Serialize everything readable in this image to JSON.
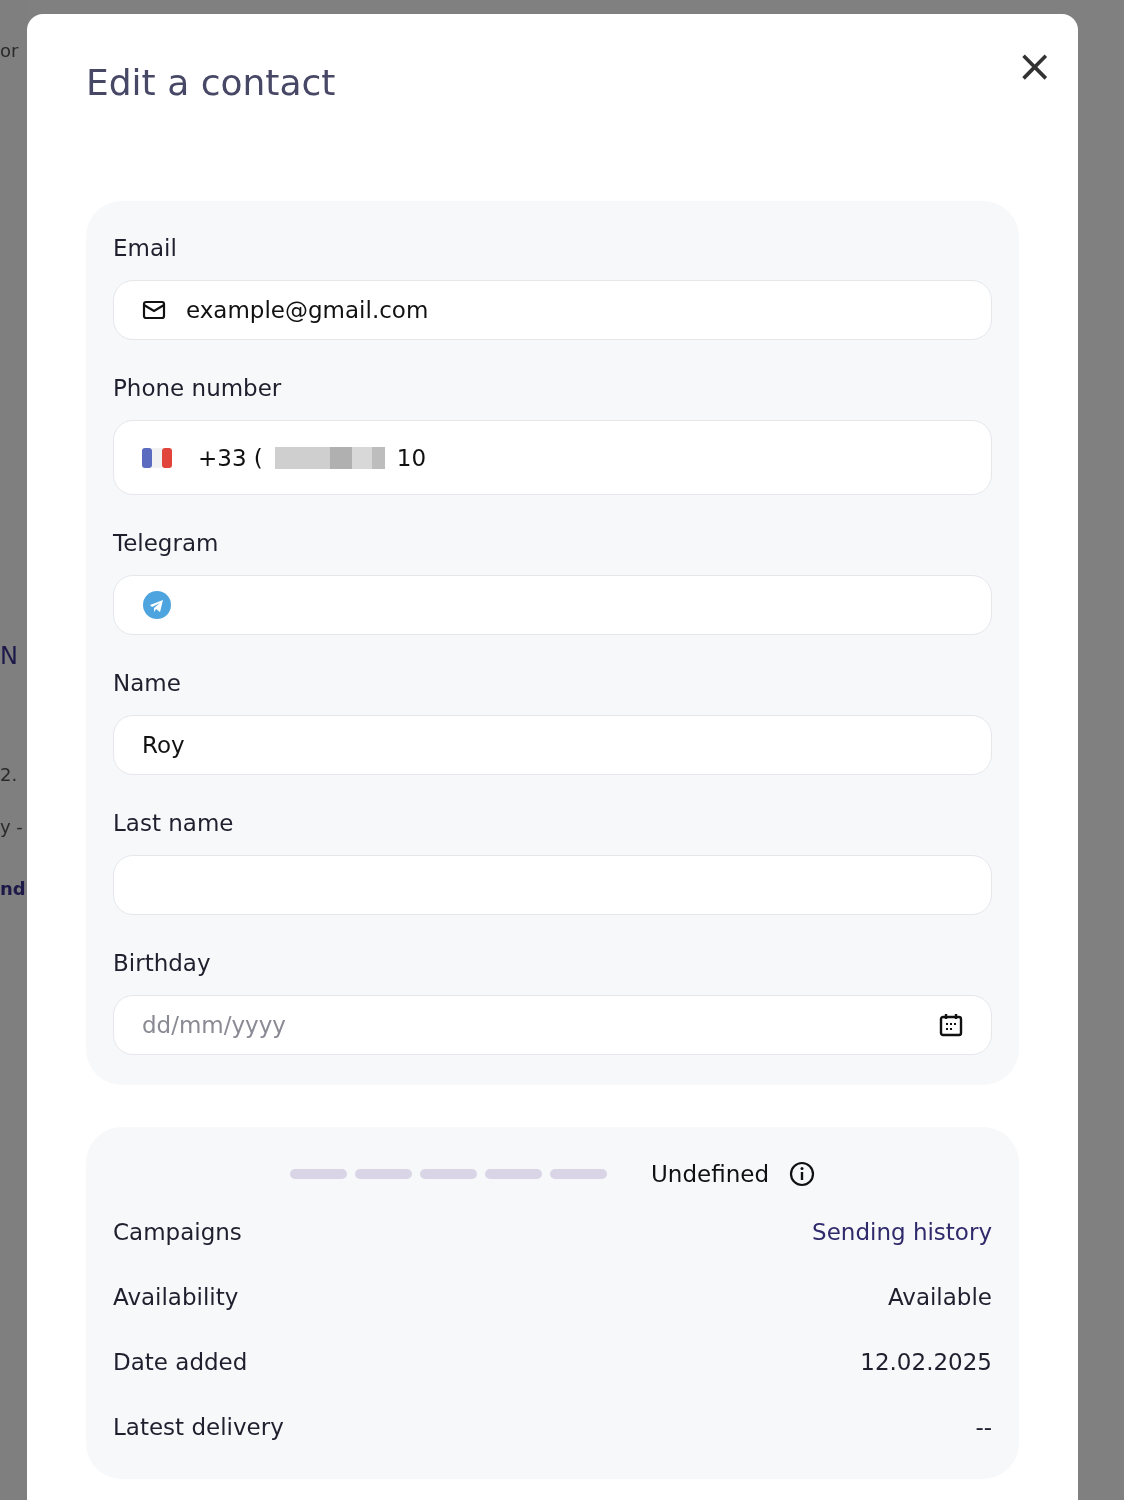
{
  "background_fragments": [
    "or",
    "N",
    "2.",
    "y -",
    "nd"
  ],
  "dialog": {
    "title": "Edit a contact",
    "close": "×"
  },
  "fields": [
    {
      "kind": "email",
      "label": "Email",
      "value": "example@gmail.com"
    },
    {
      "kind": "phone",
      "label": "Phone number",
      "prefix": "+33 (",
      "suffix": "10"
    },
    {
      "kind": "telegram",
      "label": "Telegram"
    },
    {
      "kind": "text",
      "label": "Name",
      "value": "Roy"
    },
    {
      "kind": "text",
      "label": "Last name"
    },
    {
      "kind": "date",
      "label": "Birthday",
      "placeholder": "dd/mm/yyyy"
    }
  ],
  "engagement": {
    "status": "Undefined"
  },
  "details": [
    {
      "label": "Campaigns",
      "value": "Sending history",
      "kind": "link"
    },
    {
      "label": "Availability",
      "value": "Available",
      "kind": "text"
    },
    {
      "label": "Date added",
      "value": "12.02.2025",
      "kind": "text"
    },
    {
      "label": "Latest delivery",
      "value": "--",
      "kind": "text"
    }
  ]
}
